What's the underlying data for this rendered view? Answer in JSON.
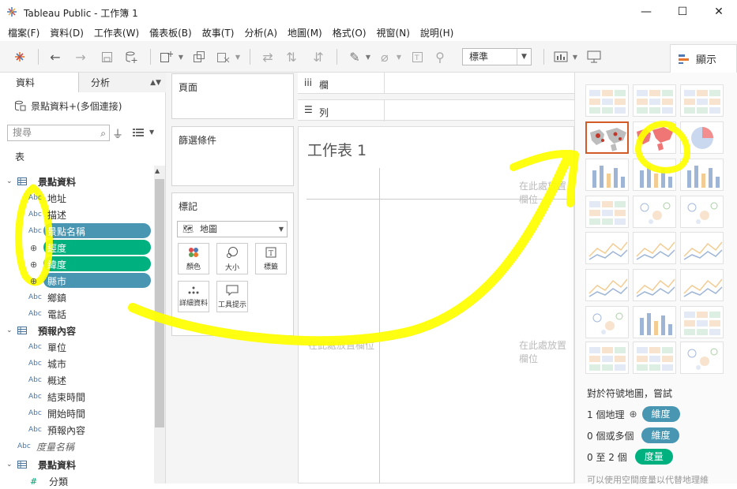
{
  "window": {
    "title": "Tableau Public - 工作簿 1",
    "min_glyph": "—",
    "max_glyph": "☐",
    "close_glyph": "✕"
  },
  "menu": [
    "檔案(F)",
    "資料(D)",
    "工作表(W)",
    "儀表板(B)",
    "故事(T)",
    "分析(A)",
    "地圖(M)",
    "格式(O)",
    "視窗(N)",
    "說明(H)"
  ],
  "toolbar": {
    "fit_value": "標準",
    "show_me_label": "顯示"
  },
  "left": {
    "tab_data": "資料",
    "tab_analysis": "分析",
    "datasource": "景點資料+(多個連接)",
    "search_placeholder": "搜尋",
    "section_tables": "表",
    "fields": [
      {
        "type": "table",
        "label": "景點資料"
      },
      {
        "type": "Abc",
        "label": "地址"
      },
      {
        "type": "Abc",
        "label": "描述"
      },
      {
        "type": "Abc",
        "label": "景點名稱",
        "pill": "blue"
      },
      {
        "type": "geo",
        "label": "經度",
        "pill": "green"
      },
      {
        "type": "geo",
        "label": "緯度",
        "pill": "green"
      },
      {
        "type": "geo",
        "label": "縣市",
        "pill": "blue"
      },
      {
        "type": "Abc",
        "label": "鄉鎮"
      },
      {
        "type": "Abc",
        "label": "電話"
      },
      {
        "type": "table",
        "label": "預報內容"
      },
      {
        "type": "Abc",
        "label": "單位"
      },
      {
        "type": "Abc",
        "label": "城市"
      },
      {
        "type": "Abc",
        "label": "概述"
      },
      {
        "type": "Abc",
        "label": "結束時間"
      },
      {
        "type": "Abc",
        "label": "開始時間"
      },
      {
        "type": "Abc",
        "label": "預報內容"
      },
      {
        "type": "Abc",
        "label": "度量名稱",
        "italic": true
      },
      {
        "type": "table",
        "label": "景點資料"
      },
      {
        "type": "#",
        "label": "分類"
      }
    ]
  },
  "shelves": {
    "pages": "頁面",
    "filters": "篩選條件",
    "marks": "標記",
    "mark_type": "地圖",
    "mark_buttons": [
      "顏色",
      "大小",
      "標籤",
      "詳細資料",
      "工具提示"
    ],
    "columns": "欄",
    "rows": "列"
  },
  "canvas": {
    "sheet_title": "工作表 1",
    "drop_field": "在此處放置欄位"
  },
  "showme": {
    "hint_title": "對於符號地圖，嘗試",
    "req1_prefix": "1 個地理",
    "req1_pill": "維度",
    "req2_prefix": "0 個或多個",
    "req2_pill": "維度",
    "req3_prefix": "0 至 2 個",
    "req3_pill": "度量",
    "footer": "可以使用空間度量以代替地理維"
  },
  "colors": {
    "dimension": "#4996b2",
    "measure": "#00b180",
    "highlight": "#ffff00",
    "selected": "#d35b28"
  }
}
